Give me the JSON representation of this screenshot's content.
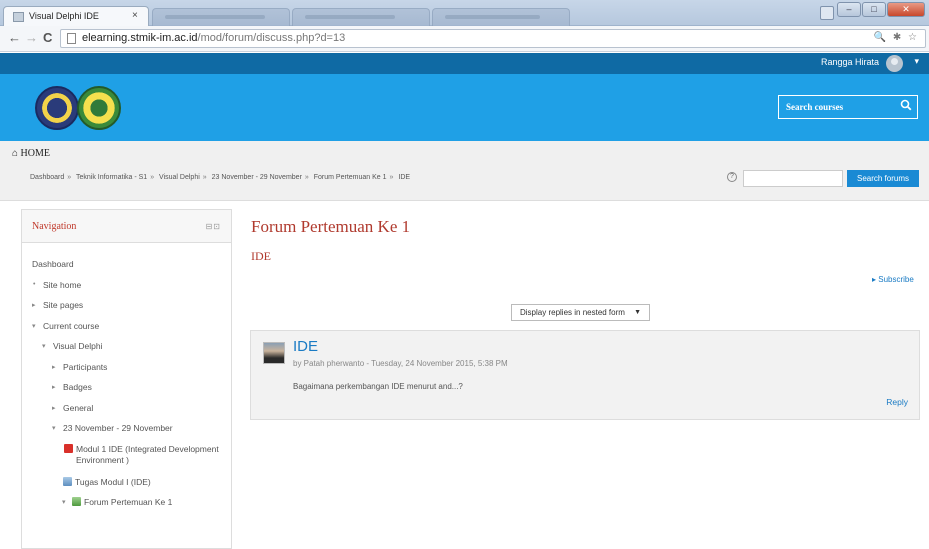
{
  "browser": {
    "active_tab_title": "Visual Delphi IDE",
    "tab_close": "×",
    "url_host": "elearning.stmik-im.ac.id",
    "url_path": "/mod/forum/discuss.php?d=13",
    "back_icon": "arrow-left-icon",
    "forward_icon": "arrow-right-icon",
    "reload_icon": "reload-icon",
    "right_icons": "🔍 ✱ ☆"
  },
  "topbar": {
    "user_name": "Rangga Hirata",
    "caret": "▾",
    "colors": {
      "bar": "#0f6aa4"
    }
  },
  "header": {
    "search_placeholder": "Search courses",
    "search_icon": "⚲",
    "colors": {
      "bg": "#1fa0e6"
    }
  },
  "homebar": {
    "home_label": "HOME",
    "home_icon": "⌂",
    "breadcrumb": [
      "Dashboard",
      "Teknik Informatika - S1",
      "Visual Delphi",
      "23 November - 29 November",
      "Forum Pertemuan Ke 1",
      "IDE"
    ],
    "breadcrumb_sep": "»",
    "help_icon": "?",
    "search_forums_button": "Search forums"
  },
  "sidebar": {
    "title": "Navigation",
    "controls": "⊟⊡",
    "items": [
      {
        "label": "Dashboard",
        "marker": "",
        "indent": 0
      },
      {
        "label": "Site home",
        "marker": "•",
        "indent": 1
      },
      {
        "label": "Site pages",
        "marker": "▸",
        "indent": 1
      },
      {
        "label": "Current course",
        "marker": "▾",
        "indent": 1
      },
      {
        "label": "Visual Delphi",
        "marker": "▾",
        "indent": 2
      },
      {
        "label": "Participants",
        "marker": "▸",
        "indent": 3
      },
      {
        "label": "Badges",
        "marker": "▸",
        "indent": 3
      },
      {
        "label": "General",
        "marker": "▸",
        "indent": 3
      },
      {
        "label": "23 November - 29 November",
        "marker": "▾",
        "indent": 3
      },
      {
        "label": "Modul 1 IDE (Integrated Development",
        "label2": "Environment )",
        "marker": "pdf",
        "indent": 4
      },
      {
        "label": "Tugas Modul I (IDE)",
        "marker": "assign",
        "indent": 4
      },
      {
        "label": "Forum Pertemuan Ke 1",
        "marker": "forum",
        "indent": 4
      }
    ]
  },
  "main": {
    "forum_title": "Forum Pertemuan Ke 1",
    "discussion_title": "IDE",
    "subscribe": "Subscribe",
    "display_mode": "Display replies in nested form",
    "post": {
      "subject": "IDE",
      "author_line": "by Patah pherwanto - Tuesday, 24 November 2015, 5:38 PM",
      "body": "Bagaimana perkembangan IDE menurut and...?",
      "reply": "Reply"
    }
  }
}
